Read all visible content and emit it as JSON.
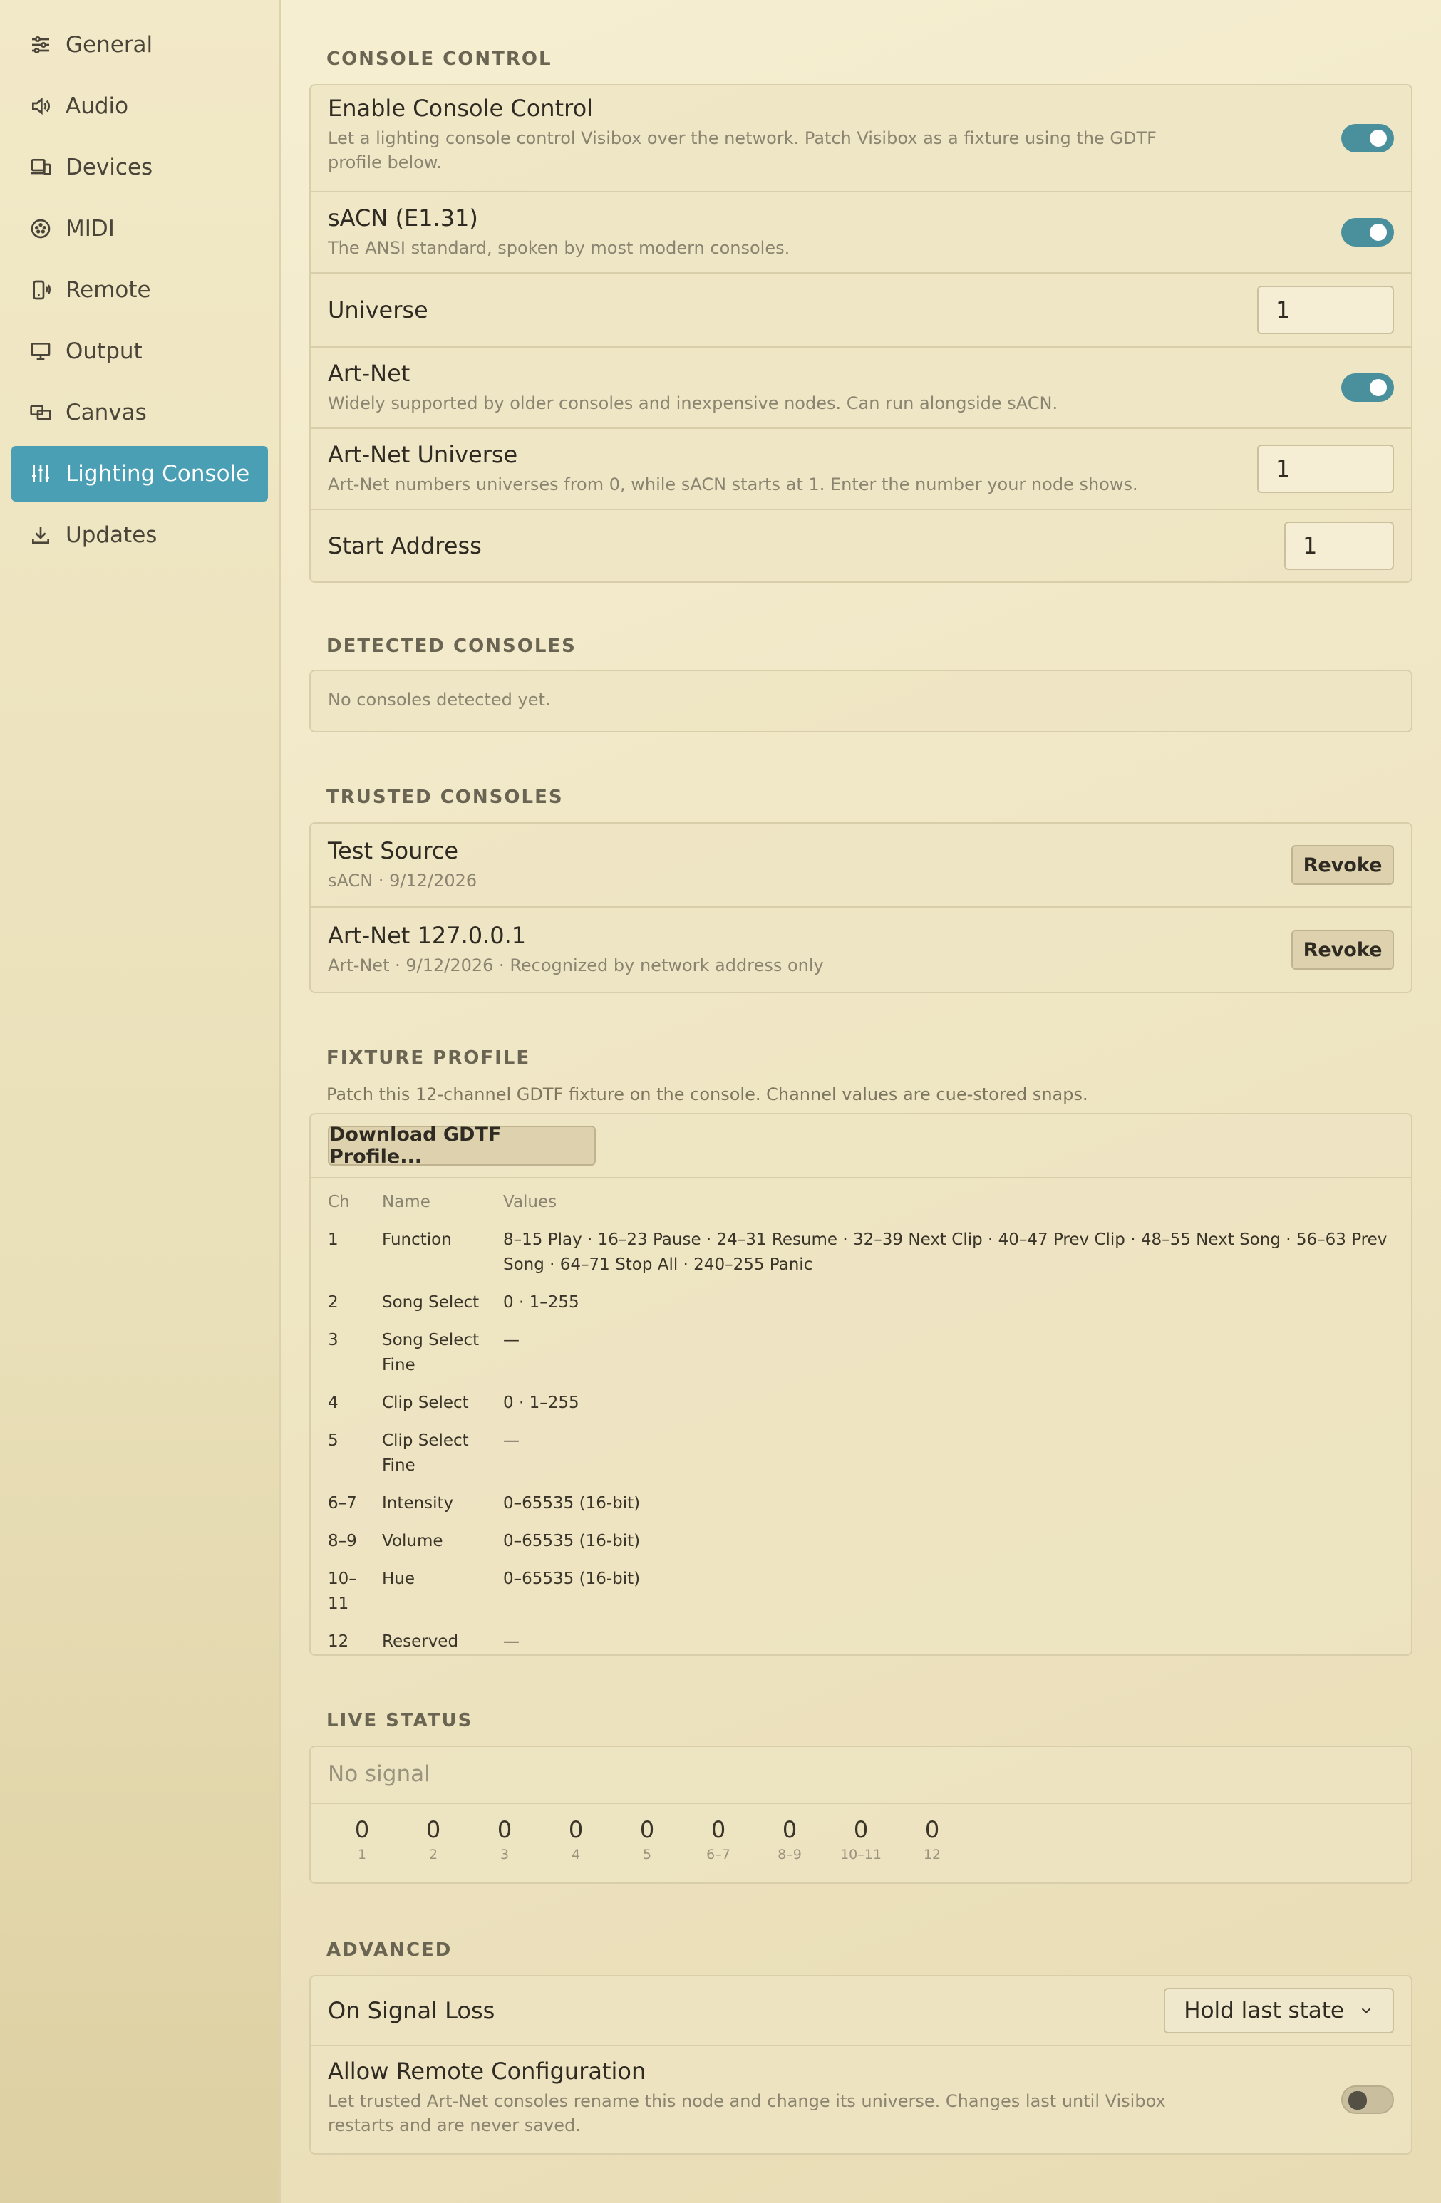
{
  "sidebar": {
    "items": [
      {
        "label": "General",
        "icon": "sliders-icon"
      },
      {
        "label": "Audio",
        "icon": "speaker-icon"
      },
      {
        "label": "Devices",
        "icon": "devices-icon"
      },
      {
        "label": "MIDI",
        "icon": "midi-icon"
      },
      {
        "label": "Remote",
        "icon": "remote-icon"
      },
      {
        "label": "Output",
        "icon": "monitor-icon"
      },
      {
        "label": "Canvas",
        "icon": "canvas-icon"
      },
      {
        "label": "Lighting Console",
        "icon": "lighting-sliders-icon",
        "active": true
      },
      {
        "label": "Updates",
        "icon": "download-icon"
      }
    ],
    "active_color": "#4a9fb4"
  },
  "console_control": {
    "title": "CONSOLE CONTROL",
    "enable": {
      "label": "Enable Console Control",
      "desc": "Let a lighting console control Visibox over the network. Patch Visibox as a fixture using the GDTF profile below.",
      "on": true
    },
    "sacn": {
      "label": "sACN (E1.31)",
      "desc": "The ANSI standard, spoken by most modern consoles.",
      "on": true
    },
    "universe": {
      "label": "Universe",
      "value": "1"
    },
    "artnet": {
      "label": "Art-Net",
      "desc": "Widely supported by older consoles and inexpensive nodes. Can run alongside sACN.",
      "on": true
    },
    "artnet_universe": {
      "label": "Art-Net Universe",
      "desc": "Art-Net numbers universes from 0, while sACN starts at 1. Enter the number your node shows.",
      "value": "1"
    },
    "start_address": {
      "label": "Start Address",
      "value": "1"
    }
  },
  "detected": {
    "title": "DETECTED CONSOLES",
    "empty": "No consoles detected yet."
  },
  "trusted": {
    "title": "TRUSTED CONSOLES",
    "items": [
      {
        "name": "Test Source",
        "meta": "sACN · 9/12/2026",
        "action": "Revoke"
      },
      {
        "name": "Art-Net 127.0.0.1",
        "meta": "Art-Net · 9/12/2026 · Recognized by network address only",
        "action": "Revoke"
      }
    ]
  },
  "fixture": {
    "title": "FIXTURE PROFILE",
    "subtitle": "Patch this 12-channel GDTF fixture on the console. Channel values are cue-stored snaps.",
    "download": "Download GDTF Profile...",
    "headers": [
      "Ch",
      "Name",
      "Values"
    ],
    "rows": [
      [
        "1",
        "Function",
        "8–15 Play · 16–23 Pause · 24–31 Resume · 32–39 Next Clip · 40–47 Prev Clip · 48–55 Next Song · 56–63 Prev Song · 64–71 Stop All · 240–255 Panic"
      ],
      [
        "2",
        "Song Select",
        "0 · 1–255"
      ],
      [
        "3",
        "Song Select Fine",
        "—"
      ],
      [
        "4",
        "Clip Select",
        "0 · 1–255"
      ],
      [
        "5",
        "Clip Select Fine",
        "—"
      ],
      [
        "6–7",
        "Intensity",
        "0–65535 (16-bit)"
      ],
      [
        "8–9",
        "Volume",
        "0–65535 (16-bit)"
      ],
      [
        "10–11",
        "Hue",
        "0–65535 (16-bit)"
      ],
      [
        "12",
        "Reserved",
        "—"
      ]
    ]
  },
  "live": {
    "title": "LIVE STATUS",
    "signal": "No signal",
    "channels": [
      {
        "value": "0",
        "label": "1"
      },
      {
        "value": "0",
        "label": "2"
      },
      {
        "value": "0",
        "label": "3"
      },
      {
        "value": "0",
        "label": "4"
      },
      {
        "value": "0",
        "label": "5"
      },
      {
        "value": "0",
        "label": "6–7"
      },
      {
        "value": "0",
        "label": "8–9"
      },
      {
        "value": "0",
        "label": "10–11"
      },
      {
        "value": "0",
        "label": "12"
      }
    ]
  },
  "advanced": {
    "title": "ADVANCED",
    "signal_loss": {
      "label": "On Signal Loss",
      "value": "Hold last state"
    },
    "remote_config": {
      "label": "Allow Remote Configuration",
      "desc": "Let trusted Art-Net consoles rename this node and change its universe. Changes last until Visibox restarts and are never saved.",
      "on": false
    }
  }
}
